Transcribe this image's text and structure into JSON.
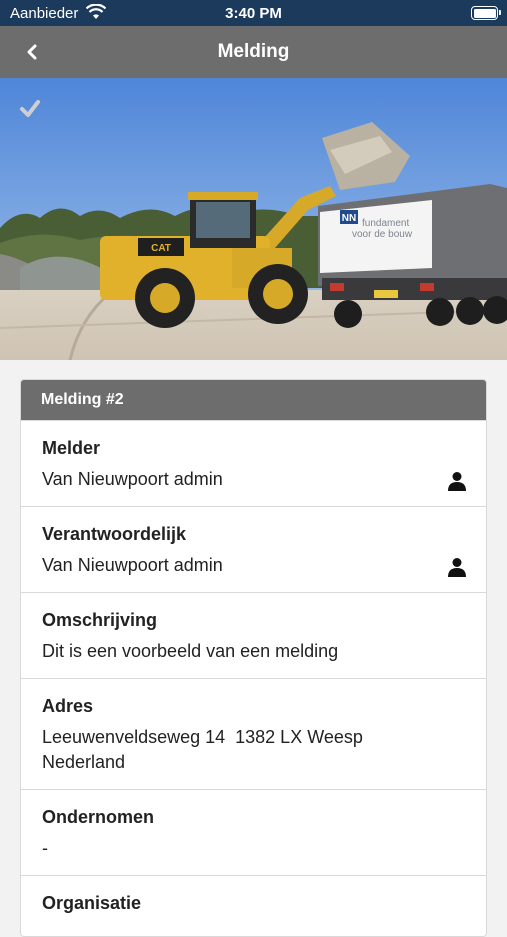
{
  "status_bar": {
    "carrier": "Aanbieder",
    "time": "3:40 PM"
  },
  "nav": {
    "title": "Melding",
    "back_icon": "chevron-left-icon"
  },
  "hero": {
    "image_alt": "wheel loader loading a dump truck",
    "check_icon": "checkmark-icon",
    "truck_text_line1": "fundament",
    "truck_text_line2": "voor de bouw",
    "truck_logo": "NN",
    "loader_brand": "CAT"
  },
  "card": {
    "header": "Melding #2",
    "fields": [
      {
        "label": "Melder",
        "value": "Van Nieuwpoort admin",
        "icon": "person-icon"
      },
      {
        "label": "Verantwoordelijk",
        "value": "Van Nieuwpoort admin",
        "icon": "person-icon"
      },
      {
        "label": "Omschrijving",
        "value": "Dit is een voorbeeld van een melding"
      },
      {
        "label": "Adres",
        "value_line1": "Leeuwenveldseweg 14  1382 LX Weesp",
        "value_line2": "Nederland"
      },
      {
        "label": "Ondernomen",
        "value": "-"
      },
      {
        "label": "Organisatie"
      }
    ]
  },
  "colors": {
    "status_bar": "#1c3a5c",
    "nav_bar": "#6d6d6d",
    "card_header": "#6d6d6d",
    "background": "#f2f2f2"
  }
}
